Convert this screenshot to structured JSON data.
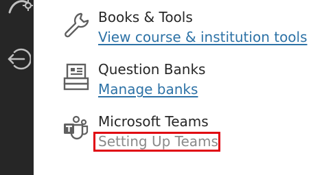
{
  "left_rail": {
    "icons": [
      "gear-arc-icon",
      "sign-out-icon"
    ]
  },
  "items": [
    {
      "title": "Books & Tools",
      "link": "View course & institution tools",
      "icon": "wrench-icon"
    },
    {
      "title": "Question Banks",
      "link": "Manage banks",
      "icon": "question-bank-icon"
    },
    {
      "title": "Microsoft Teams",
      "link": "Setting Up Teams",
      "icon": "microsoft-teams-icon",
      "link_state": "disabled"
    }
  ],
  "colors": {
    "rail": "#262626",
    "text": "#262626",
    "link": "#2d72a6",
    "disabled_link": "#8a8a8a",
    "highlight": "#e0000f"
  }
}
